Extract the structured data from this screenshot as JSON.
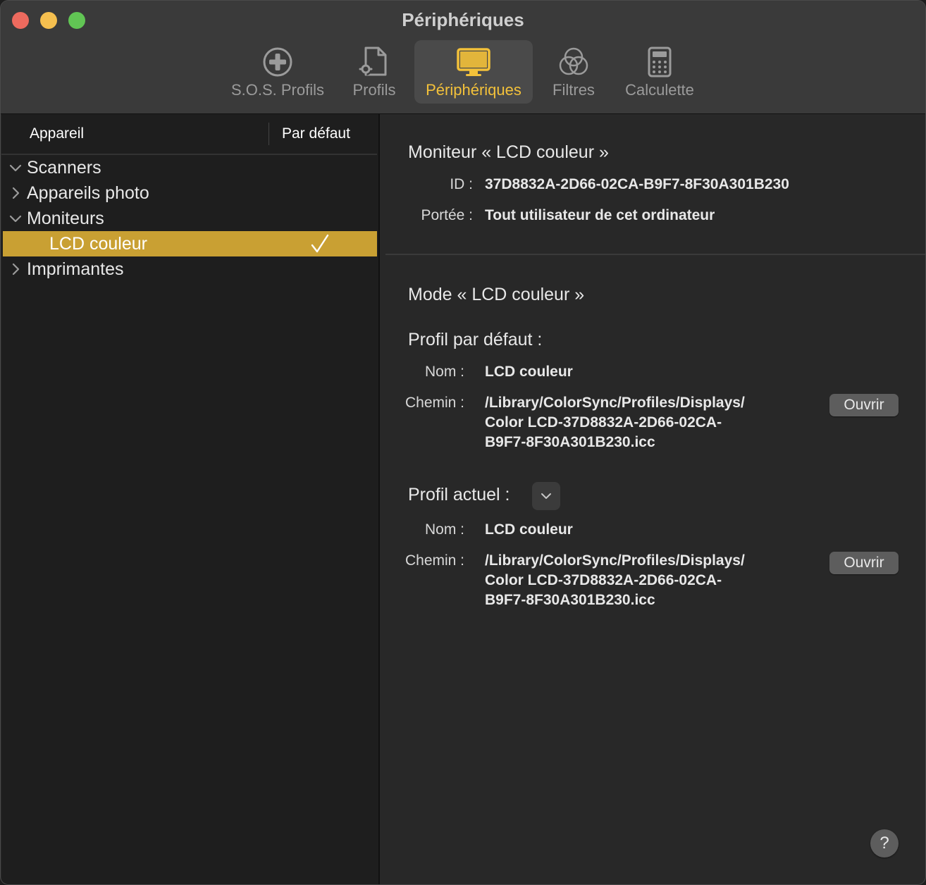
{
  "window": {
    "title": "Périphériques"
  },
  "toolbar": {
    "items": [
      {
        "label": "S.O.S. Profils",
        "icon": "first-aid-icon",
        "active": false
      },
      {
        "label": "Profils",
        "icon": "profile-document-icon",
        "active": false
      },
      {
        "label": "Périphériques",
        "icon": "display-icon",
        "active": true
      },
      {
        "label": "Filtres",
        "icon": "filters-icon",
        "active": false
      },
      {
        "label": "Calculette",
        "icon": "calculator-icon",
        "active": false
      }
    ]
  },
  "sidebar": {
    "columns": {
      "device": "Appareil",
      "default": "Par défaut"
    },
    "items": [
      {
        "label": "Scanners",
        "expanded": true
      },
      {
        "label": "Appareils photo",
        "expanded": false
      },
      {
        "label": "Moniteurs",
        "expanded": true
      },
      {
        "label": "LCD couleur",
        "selected": true,
        "is_default": true
      },
      {
        "label": "Imprimantes",
        "expanded": false
      }
    ]
  },
  "detail": {
    "monitor_title": "Moniteur « LCD couleur »",
    "id_label": "ID :",
    "id_value": "37D8832A-2D66-02CA-B9F7-8F30A301B230",
    "scope_label": "Portée :",
    "scope_value": "Tout utilisateur de cet ordinateur",
    "mode_title": "Mode « LCD couleur »",
    "default_profile": {
      "title": "Profil par défaut :",
      "name_label": "Nom :",
      "name_value": "LCD couleur",
      "path_label": "Chemin :",
      "path_line1": "/Library/ColorSync/Profiles/Displays/",
      "path_line2": "Color LCD-37D8832A-2D66-02CA-",
      "path_line3": "B9F7-8F30A301B230.icc",
      "open_button": "Ouvrir"
    },
    "current_profile": {
      "title": "Profil actuel :",
      "name_label": "Nom :",
      "name_value": "LCD couleur",
      "path_label": "Chemin :",
      "path_line1": "/Library/ColorSync/Profiles/Displays/",
      "path_line2": "Color LCD-37D8832A-2D66-02CA-",
      "path_line3": "B9F7-8F30A301B230.icc",
      "open_button": "Ouvrir"
    },
    "help_button": "?"
  },
  "colors": {
    "accent": "#f3c13a",
    "selection": "#c9a033"
  }
}
